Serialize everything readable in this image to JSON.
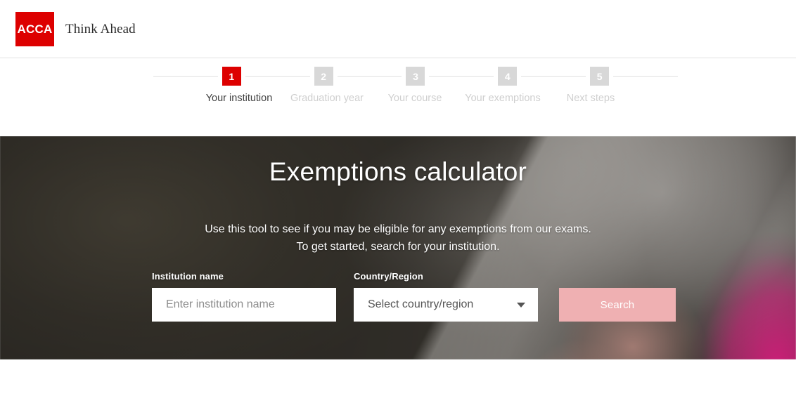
{
  "brand": {
    "logo_text": "ACCA",
    "logo_color": "#dd0000",
    "tagline": "Think Ahead"
  },
  "stepper": {
    "steps": [
      {
        "number": "1",
        "label": "Your institution",
        "active": true
      },
      {
        "number": "2",
        "label": "Graduation year",
        "active": false
      },
      {
        "number": "3",
        "label": "Your course",
        "active": false
      },
      {
        "number": "4",
        "label": "Your exemptions",
        "active": false
      },
      {
        "number": "5",
        "label": "Next steps",
        "active": false
      }
    ],
    "active_color": "#dd0000",
    "inactive_color": "#d8d8d8"
  },
  "hero": {
    "title": "Exemptions calculator",
    "description_line1": "Use this tool to see if you may be eligible for any exemptions from our exams.",
    "description_line2": "To get started, search for your institution."
  },
  "form": {
    "institution": {
      "label": "Institution name",
      "placeholder": "Enter institution name",
      "value": ""
    },
    "country": {
      "label": "Country/Region",
      "selected": "Select country/region",
      "caret_icon": "chevron-down-icon"
    },
    "search_button": {
      "label": "Search",
      "color": "#efb0b2",
      "disabled": true
    }
  }
}
